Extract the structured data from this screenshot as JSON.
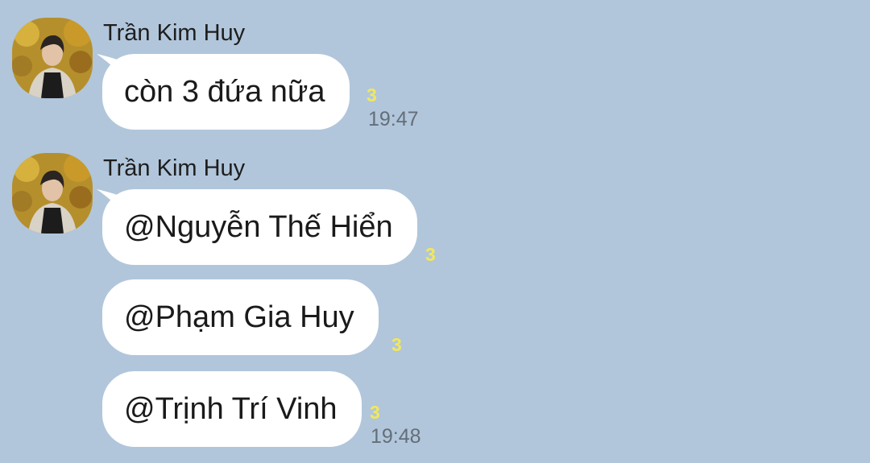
{
  "messages": [
    {
      "sender": "Trần Kim Huy",
      "bubbles": [
        {
          "text": "còn 3 đứa nữa",
          "unread": "3",
          "time": "19:47"
        }
      ]
    },
    {
      "sender": "Trần Kim Huy",
      "bubbles": [
        {
          "text": "@Nguyễn Thế Hiển",
          "unread": "3"
        },
        {
          "text": "@Phạm Gia Huy",
          "unread": "3"
        },
        {
          "text": "@Trịnh Trí Vinh",
          "unread": "3",
          "time": "19:48"
        }
      ]
    }
  ],
  "colors": {
    "background": "#b1c6db",
    "bubble": "#ffffff",
    "unread": "#f2e85a",
    "time": "#646e78"
  }
}
